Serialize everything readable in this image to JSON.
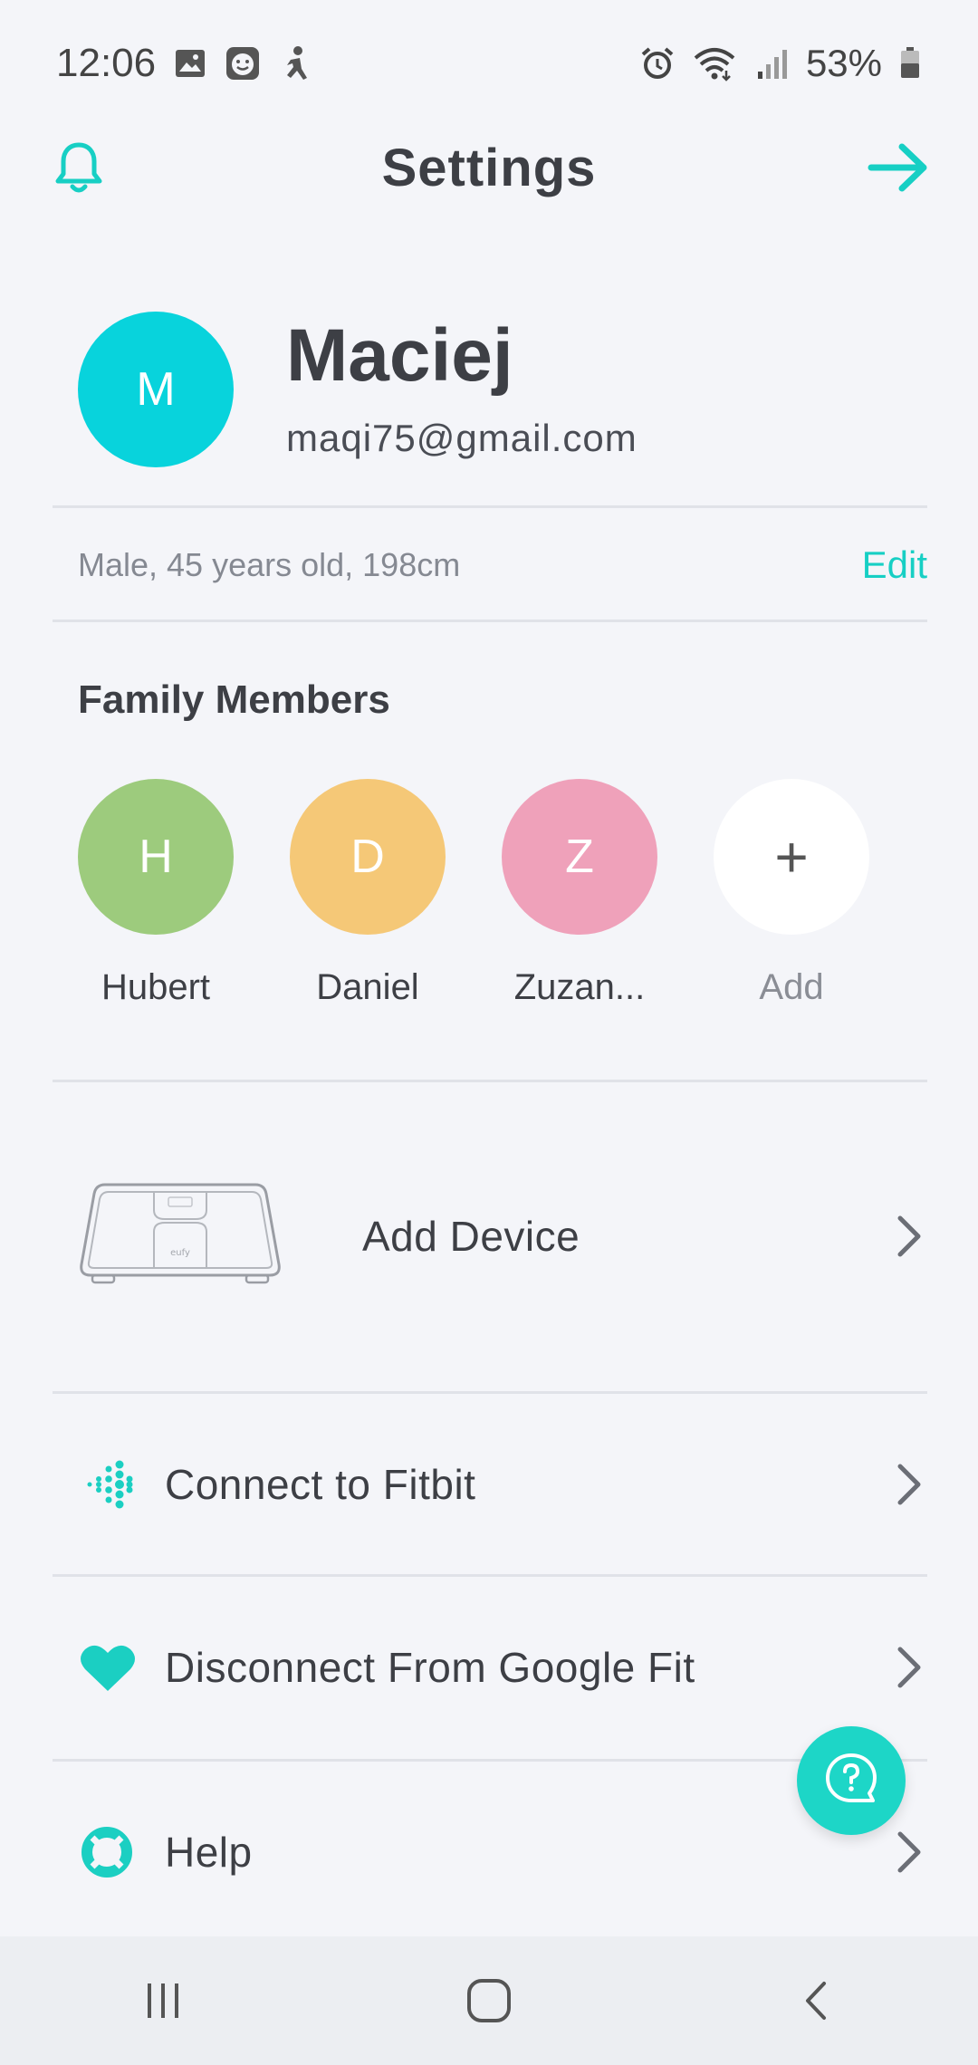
{
  "status_bar": {
    "time": "12:06",
    "battery_pct": "53%",
    "icons": [
      "gallery-icon",
      "face-icon",
      "runner-icon",
      "alarm-icon",
      "wifi-icon",
      "signal-icon",
      "battery-icon"
    ]
  },
  "header": {
    "title": "Settings",
    "left_icon": "bell-icon",
    "right_icon": "arrow-right-icon"
  },
  "profile": {
    "initial": "M",
    "name": "Maciej",
    "email": "maqi75@gmail.com",
    "info": "Male, 45 years old, 198cm",
    "edit_label": "Edit"
  },
  "family": {
    "title": "Family Members",
    "members": [
      {
        "initial": "H",
        "name": "Hubert",
        "color": "#9dcb7d"
      },
      {
        "initial": "D",
        "name": "Daniel",
        "color": "#f5c877"
      },
      {
        "initial": "Z",
        "name": "Zuzan...",
        "color": "#efa1ba"
      }
    ],
    "add": {
      "symbol": "+",
      "label": "Add"
    }
  },
  "device": {
    "label": "Add Device",
    "image_brand": "eufy"
  },
  "list": [
    {
      "icon": "fitbit-icon",
      "label": "Connect to Fitbit"
    },
    {
      "icon": "heart-icon",
      "label": "Disconnect From Google Fit"
    },
    {
      "icon": "lifebuoy-icon",
      "label": "Help"
    }
  ],
  "colors": {
    "accent": "#17cfc4",
    "avatar_main": "#08d3dc",
    "background": "#f4f5f9"
  }
}
